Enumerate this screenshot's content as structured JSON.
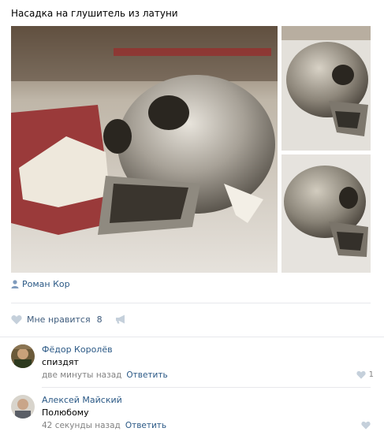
{
  "post": {
    "title": "Насадка на глушитель из латуни",
    "author": "Роман Кор"
  },
  "likes": {
    "label": "Мне нравится",
    "count": "8"
  },
  "comments": [
    {
      "name": "Фёдор Королёв",
      "text": "спиздят",
      "time": "две минуты назад",
      "reply": "Ответить",
      "likes": "1"
    },
    {
      "name": "Алексей Майский",
      "text": "Полюбому",
      "time": "42 секунды назад",
      "reply": "Ответить",
      "likes": ""
    }
  ],
  "icons": {
    "author": "user-icon",
    "like": "heart-icon",
    "share": "megaphone-icon"
  },
  "colors": {
    "link": "#2a5885",
    "meta": "#828282",
    "icon": "#c5d0db"
  }
}
